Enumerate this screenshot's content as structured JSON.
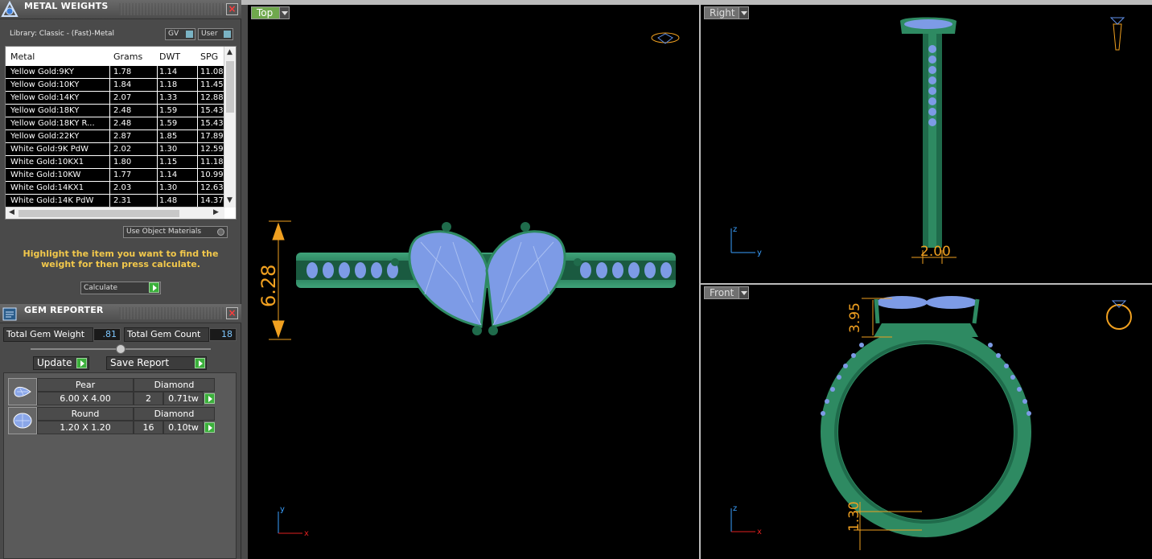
{
  "metal_panel": {
    "title": "METAL WEIGHTS",
    "library_label": "Library: Classic - (Fast)-Metal",
    "gv_label": "GV",
    "user_label": "User",
    "columns": [
      "Metal",
      "Grams",
      "DWT",
      "SPG"
    ],
    "rows": [
      {
        "metal": "Yellow Gold:9KY",
        "grams": "1.78",
        "dwt": "1.14",
        "spg": "11.08"
      },
      {
        "metal": "Yellow Gold:10KY",
        "grams": "1.84",
        "dwt": "1.18",
        "spg": "11.45"
      },
      {
        "metal": "Yellow Gold:14KY",
        "grams": "2.07",
        "dwt": "1.33",
        "spg": "12.88"
      },
      {
        "metal": "Yellow Gold:18KY",
        "grams": "2.48",
        "dwt": "1.59",
        "spg": "15.43"
      },
      {
        "metal": "Yellow Gold:18KY R...",
        "grams": "2.48",
        "dwt": "1.59",
        "spg": "15.43"
      },
      {
        "metal": "Yellow Gold:22KY",
        "grams": "2.87",
        "dwt": "1.85",
        "spg": "17.89"
      },
      {
        "metal": "White Gold:9K PdW",
        "grams": "2.02",
        "dwt": "1.30",
        "spg": "12.59"
      },
      {
        "metal": "White Gold:10KX1",
        "grams": "1.80",
        "dwt": "1.15",
        "spg": "11.18"
      },
      {
        "metal": "White Gold:10KW",
        "grams": "1.77",
        "dwt": "1.14",
        "spg": "10.99"
      },
      {
        "metal": "White Gold:14KX1",
        "grams": "2.03",
        "dwt": "1.30",
        "spg": "12.63"
      },
      {
        "metal": "White Gold:14K PdW",
        "grams": "2.31",
        "dwt": "1.48",
        "spg": "14.37"
      }
    ],
    "use_object_materials": "Use Object Materials",
    "hint": "Highlight the item you want to find the weight for then press calculate.",
    "calculate_label": "Calculate"
  },
  "gem_panel": {
    "title": "GEM REPORTER",
    "total_weight_label": "Total Gem Weight",
    "total_weight": ".81",
    "total_count_label": "Total Gem Count",
    "total_count": "18",
    "update_label": "Update",
    "save_label": "Save Report",
    "gems": [
      {
        "shape": "Pear",
        "material": "Diamond",
        "size": "6.00 X 4.00",
        "count": "2",
        "weight": "0.71tw"
      },
      {
        "shape": "Round",
        "material": "Diamond",
        "size": "1.20 X 1.20",
        "count": "16",
        "weight": "0.10tw"
      }
    ]
  },
  "viewports": {
    "top": {
      "label": "Top",
      "dimension": "6.28",
      "axis_v": "y",
      "axis_h": "x"
    },
    "right": {
      "label": "Right",
      "dimension": "2.00",
      "axis_v": "z",
      "axis_h": "y"
    },
    "front": {
      "label": "Front",
      "dimension_a": "3.95",
      "dimension_b": "1.30",
      "axis_v": "z",
      "axis_h": "x"
    }
  },
  "colors": {
    "metal": "#2e8a62",
    "gem": "#7d9be6",
    "dimension": "#f0a020",
    "hint": "#f2c84b"
  }
}
